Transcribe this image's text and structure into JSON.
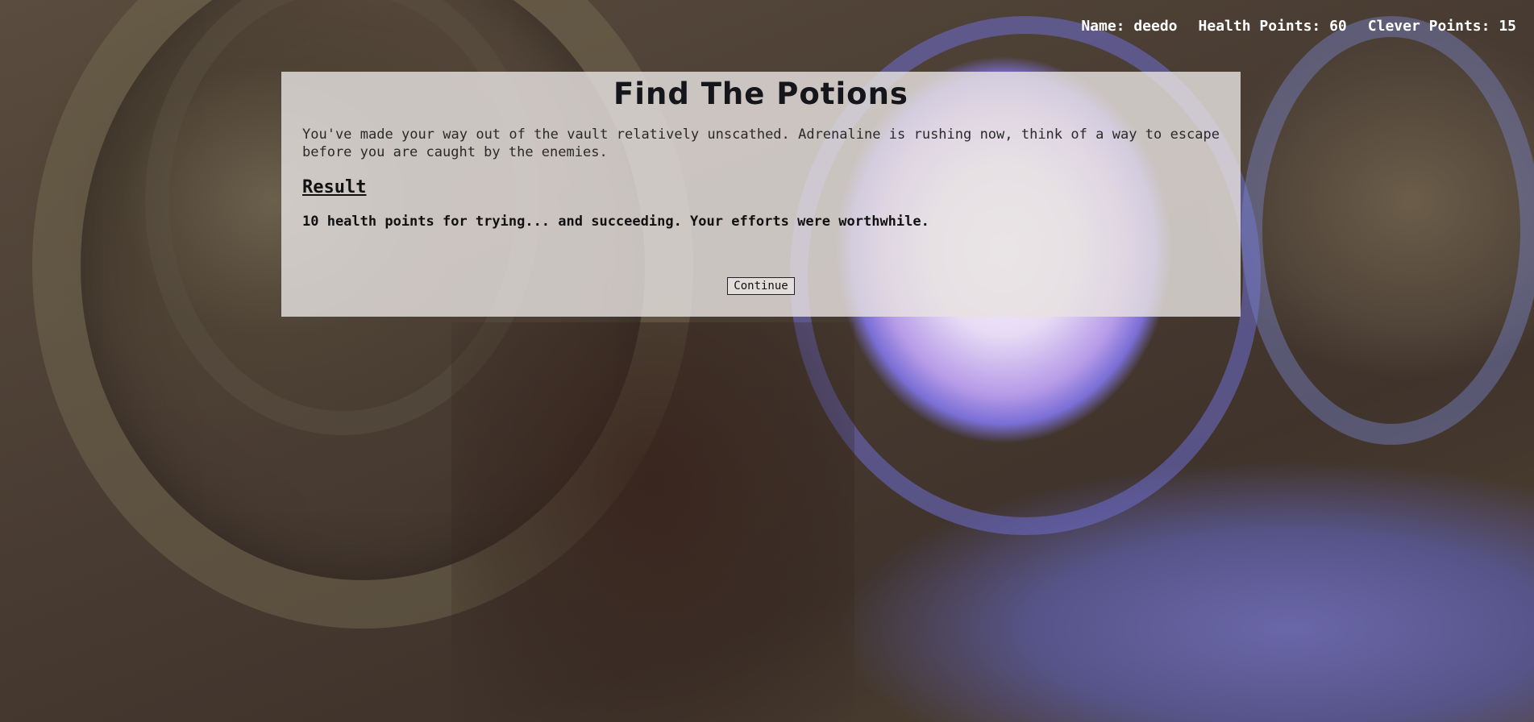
{
  "player": {
    "name_text": "Name: deedo",
    "health_text": "Health Points: 60",
    "clever_text": "Clever Points: 15"
  },
  "story": {
    "title": "Find The Potions",
    "narrative": "You've made your way out of the vault relatively unscathed. Adrenaline is rushing now, think of a way to escape before you are caught by the enemies.",
    "result_heading": "Result",
    "result_text": "10 health points for trying... and succeeding. Your efforts were worthwhile.",
    "continue_label": "Continue"
  },
  "colors": {
    "panel_bg": "#e6e2e0",
    "stats_text": "#ffffff",
    "title_text": "#15161c"
  }
}
